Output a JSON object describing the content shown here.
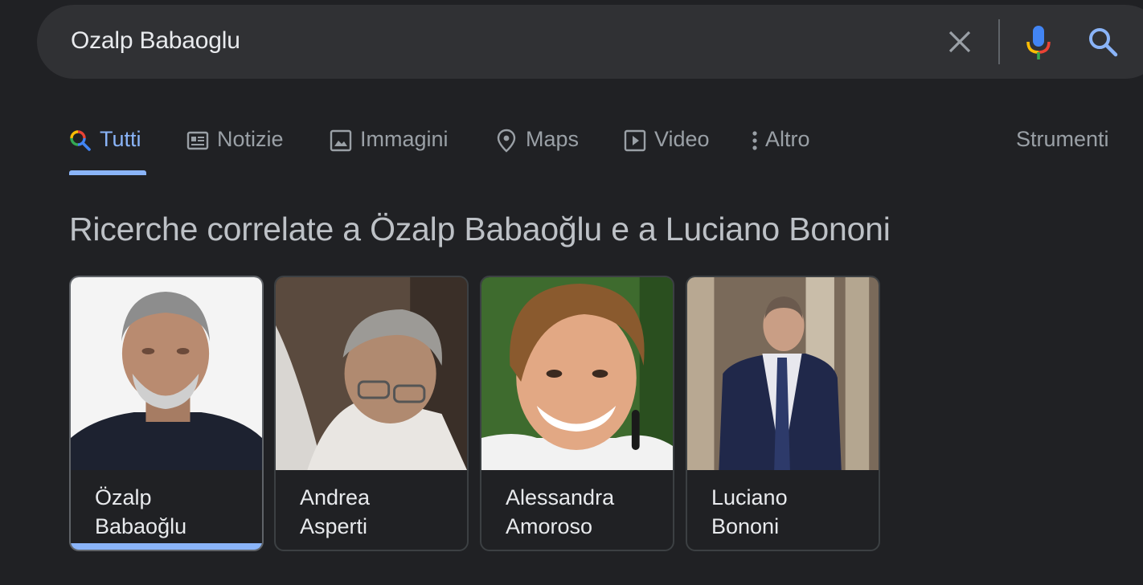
{
  "search": {
    "query": "Ozalp Babaoglu"
  },
  "tabs": [
    {
      "label": "Tutti",
      "icon": "search-icon",
      "active": true
    },
    {
      "label": "Notizie",
      "icon": "news-icon"
    },
    {
      "label": "Immagini",
      "icon": "image-icon"
    },
    {
      "label": "Maps",
      "icon": "map-pin-icon"
    },
    {
      "label": "Video",
      "icon": "play-icon"
    },
    {
      "label": "Altro",
      "icon": "more-vertical-icon"
    }
  ],
  "tools_label": "Strumenti",
  "related": {
    "heading": "Ricerche correlate a Özalp Babaoğlu e a Luciano Bononi",
    "cards": [
      {
        "first": "Özalp",
        "last": "Babaoğlu",
        "selected": true
      },
      {
        "first": "Andrea",
        "last": "Asperti"
      },
      {
        "first": "Alessandra",
        "last": "Amoroso"
      },
      {
        "first": "Luciano",
        "last": "Bononi"
      }
    ]
  },
  "colors": {
    "background": "#202124",
    "searchbar": "#303134",
    "accent": "#8ab4f8",
    "muted_text": "#9aa0a6"
  }
}
